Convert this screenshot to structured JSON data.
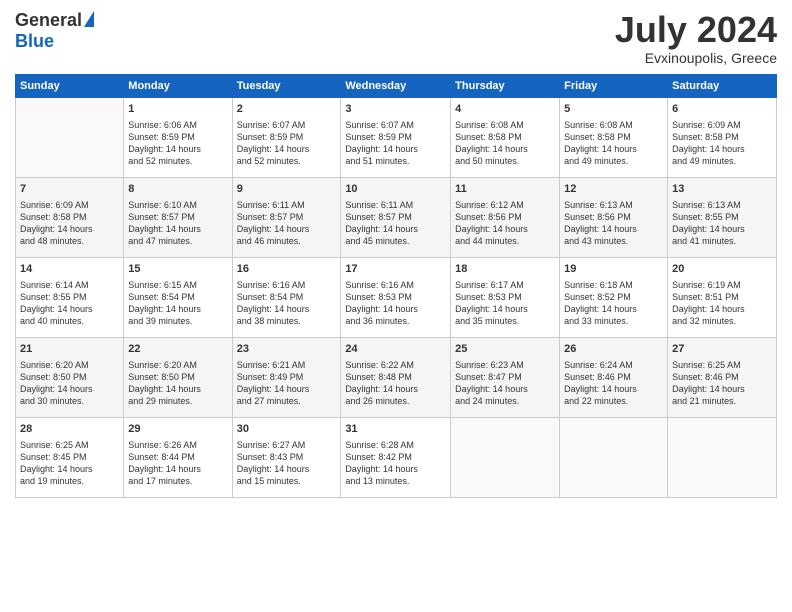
{
  "logo": {
    "general": "General",
    "blue": "Blue"
  },
  "title": "July 2024",
  "location": "Evxinoupolis, Greece",
  "days_header": [
    "Sunday",
    "Monday",
    "Tuesday",
    "Wednesday",
    "Thursday",
    "Friday",
    "Saturday"
  ],
  "weeks": [
    [
      {
        "num": "",
        "info": ""
      },
      {
        "num": "1",
        "info": "Sunrise: 6:06 AM\nSunset: 8:59 PM\nDaylight: 14 hours\nand 52 minutes."
      },
      {
        "num": "2",
        "info": "Sunrise: 6:07 AM\nSunset: 8:59 PM\nDaylight: 14 hours\nand 52 minutes."
      },
      {
        "num": "3",
        "info": "Sunrise: 6:07 AM\nSunset: 8:59 PM\nDaylight: 14 hours\nand 51 minutes."
      },
      {
        "num": "4",
        "info": "Sunrise: 6:08 AM\nSunset: 8:58 PM\nDaylight: 14 hours\nand 50 minutes."
      },
      {
        "num": "5",
        "info": "Sunrise: 6:08 AM\nSunset: 8:58 PM\nDaylight: 14 hours\nand 49 minutes."
      },
      {
        "num": "6",
        "info": "Sunrise: 6:09 AM\nSunset: 8:58 PM\nDaylight: 14 hours\nand 49 minutes."
      }
    ],
    [
      {
        "num": "7",
        "info": "Sunrise: 6:09 AM\nSunset: 8:58 PM\nDaylight: 14 hours\nand 48 minutes."
      },
      {
        "num": "8",
        "info": "Sunrise: 6:10 AM\nSunset: 8:57 PM\nDaylight: 14 hours\nand 47 minutes."
      },
      {
        "num": "9",
        "info": "Sunrise: 6:11 AM\nSunset: 8:57 PM\nDaylight: 14 hours\nand 46 minutes."
      },
      {
        "num": "10",
        "info": "Sunrise: 6:11 AM\nSunset: 8:57 PM\nDaylight: 14 hours\nand 45 minutes."
      },
      {
        "num": "11",
        "info": "Sunrise: 6:12 AM\nSunset: 8:56 PM\nDaylight: 14 hours\nand 44 minutes."
      },
      {
        "num": "12",
        "info": "Sunrise: 6:13 AM\nSunset: 8:56 PM\nDaylight: 14 hours\nand 43 minutes."
      },
      {
        "num": "13",
        "info": "Sunrise: 6:13 AM\nSunset: 8:55 PM\nDaylight: 14 hours\nand 41 minutes."
      }
    ],
    [
      {
        "num": "14",
        "info": "Sunrise: 6:14 AM\nSunset: 8:55 PM\nDaylight: 14 hours\nand 40 minutes."
      },
      {
        "num": "15",
        "info": "Sunrise: 6:15 AM\nSunset: 8:54 PM\nDaylight: 14 hours\nand 39 minutes."
      },
      {
        "num": "16",
        "info": "Sunrise: 6:16 AM\nSunset: 8:54 PM\nDaylight: 14 hours\nand 38 minutes."
      },
      {
        "num": "17",
        "info": "Sunrise: 6:16 AM\nSunset: 8:53 PM\nDaylight: 14 hours\nand 36 minutes."
      },
      {
        "num": "18",
        "info": "Sunrise: 6:17 AM\nSunset: 8:53 PM\nDaylight: 14 hours\nand 35 minutes."
      },
      {
        "num": "19",
        "info": "Sunrise: 6:18 AM\nSunset: 8:52 PM\nDaylight: 14 hours\nand 33 minutes."
      },
      {
        "num": "20",
        "info": "Sunrise: 6:19 AM\nSunset: 8:51 PM\nDaylight: 14 hours\nand 32 minutes."
      }
    ],
    [
      {
        "num": "21",
        "info": "Sunrise: 6:20 AM\nSunset: 8:50 PM\nDaylight: 14 hours\nand 30 minutes."
      },
      {
        "num": "22",
        "info": "Sunrise: 6:20 AM\nSunset: 8:50 PM\nDaylight: 14 hours\nand 29 minutes."
      },
      {
        "num": "23",
        "info": "Sunrise: 6:21 AM\nSunset: 8:49 PM\nDaylight: 14 hours\nand 27 minutes."
      },
      {
        "num": "24",
        "info": "Sunrise: 6:22 AM\nSunset: 8:48 PM\nDaylight: 14 hours\nand 26 minutes."
      },
      {
        "num": "25",
        "info": "Sunrise: 6:23 AM\nSunset: 8:47 PM\nDaylight: 14 hours\nand 24 minutes."
      },
      {
        "num": "26",
        "info": "Sunrise: 6:24 AM\nSunset: 8:46 PM\nDaylight: 14 hours\nand 22 minutes."
      },
      {
        "num": "27",
        "info": "Sunrise: 6:25 AM\nSunset: 8:46 PM\nDaylight: 14 hours\nand 21 minutes."
      }
    ],
    [
      {
        "num": "28",
        "info": "Sunrise: 6:25 AM\nSunset: 8:45 PM\nDaylight: 14 hours\nand 19 minutes."
      },
      {
        "num": "29",
        "info": "Sunrise: 6:26 AM\nSunset: 8:44 PM\nDaylight: 14 hours\nand 17 minutes."
      },
      {
        "num": "30",
        "info": "Sunrise: 6:27 AM\nSunset: 8:43 PM\nDaylight: 14 hours\nand 15 minutes."
      },
      {
        "num": "31",
        "info": "Sunrise: 6:28 AM\nSunset: 8:42 PM\nDaylight: 14 hours\nand 13 minutes."
      },
      {
        "num": "",
        "info": ""
      },
      {
        "num": "",
        "info": ""
      },
      {
        "num": "",
        "info": ""
      }
    ]
  ]
}
